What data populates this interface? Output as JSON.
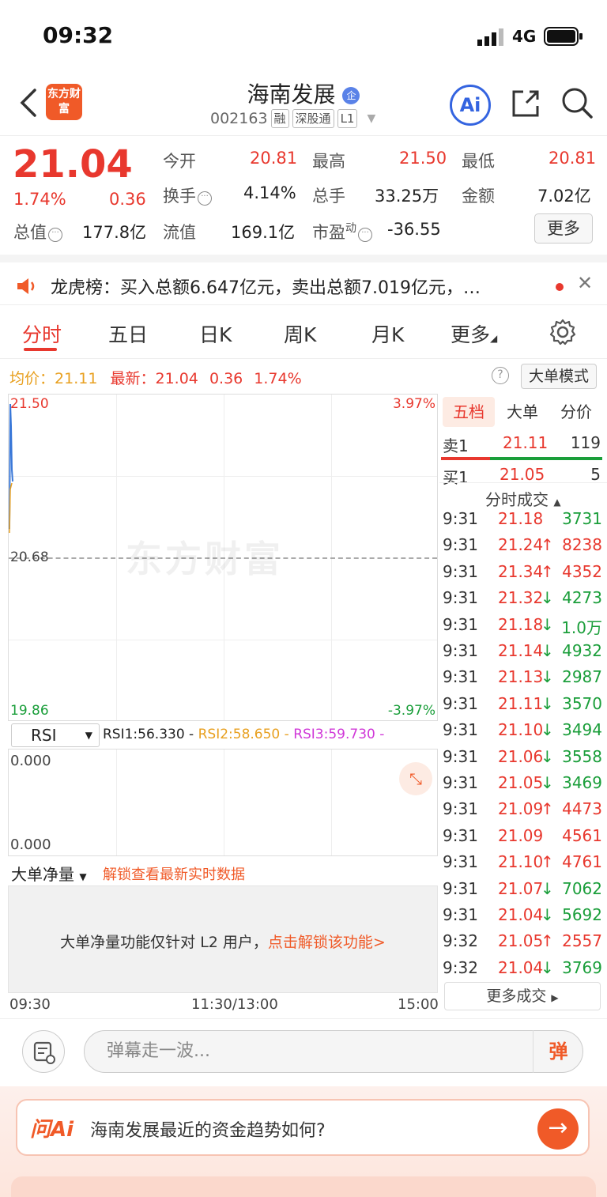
{
  "status": {
    "time": "09:32",
    "network": "4G"
  },
  "header": {
    "logo_text": "东方财富",
    "stock_name": "海南发展",
    "stock_code": "002163",
    "tags": [
      "融",
      "深股通",
      "L1"
    ],
    "ai_label": "Ai"
  },
  "quote": {
    "price": "21.04",
    "change_pct": "1.74%",
    "change_amt": "0.36",
    "open_label": "今开",
    "open": "20.81",
    "high_label": "最高",
    "high": "21.50",
    "low_label": "最低",
    "low": "20.81",
    "turnover_label": "换手",
    "turnover": "4.14%",
    "volume_label": "总手",
    "volume": "33.25万",
    "amount_label": "金额",
    "amount": "7.02亿",
    "mktcap_label": "总值",
    "mktcap": "177.8亿",
    "float_label": "流值",
    "float": "169.1亿",
    "pe_label": "市盈",
    "pe_sup": "动",
    "pe": "-36.55",
    "more_label": "更多"
  },
  "banner": {
    "text": "龙虎榜：买入总额6.647亿元，卖出总额7.019亿元，…"
  },
  "tabs": {
    "items": [
      "分时",
      "五日",
      "日K",
      "周K",
      "月K",
      "更多"
    ]
  },
  "avgline": {
    "avg_label": "均价：",
    "avg": "21.11",
    "latest_label": "最新：",
    "latest": "21.04",
    "chg": "0.36",
    "pct": "1.74%",
    "mode_label": "大单模式"
  },
  "chart": {
    "y_top": "21.50",
    "y_mid": "20.68",
    "y_bot": "19.86",
    "pct_top": "3.97%",
    "pct_bot": "-3.97%",
    "watermark": "东方财富"
  },
  "rsi": {
    "selector": "RSI",
    "rsi1": "RSI1:56.330 -",
    "rsi2": "RSI2:58.650 -",
    "rsi3": "RSI3:59.730 -",
    "y_top": "0.000",
    "y_bot": "0.000"
  },
  "bigorder": {
    "selector": "大单净量",
    "unlock_link": "解锁查看最新实时数据",
    "panel_text": "大单净量功能仅针对 L2 用户，",
    "panel_link": "点击解锁该功能>"
  },
  "time_axis": {
    "start": "09:30",
    "mid": "11:30/13:00",
    "end": "15:00"
  },
  "book": {
    "tabs": [
      "五档",
      "大单",
      "分价"
    ],
    "sell1": {
      "label": "卖1",
      "price": "21.11",
      "vol": "119"
    },
    "buy1": {
      "label": "买1",
      "price": "21.05",
      "vol": "5"
    },
    "trades_title": "分时成交",
    "trades": [
      {
        "t": "9:31",
        "p": "21.18",
        "a": "",
        "v": "3731",
        "c": "green"
      },
      {
        "t": "9:31",
        "p": "21.24",
        "a": "↑",
        "v": "8238",
        "c": "red"
      },
      {
        "t": "9:31",
        "p": "21.34",
        "a": "↑",
        "v": "4352",
        "c": "red"
      },
      {
        "t": "9:31",
        "p": "21.32",
        "a": "↓",
        "v": "4273",
        "c": "green"
      },
      {
        "t": "9:31",
        "p": "21.18",
        "a": "↓",
        "v": "1.0万",
        "c": "green"
      },
      {
        "t": "9:31",
        "p": "21.14",
        "a": "↓",
        "v": "4932",
        "c": "green"
      },
      {
        "t": "9:31",
        "p": "21.13",
        "a": "↓",
        "v": "2987",
        "c": "green"
      },
      {
        "t": "9:31",
        "p": "21.11",
        "a": "↓",
        "v": "3570",
        "c": "green"
      },
      {
        "t": "9:31",
        "p": "21.10",
        "a": "↓",
        "v": "3494",
        "c": "green"
      },
      {
        "t": "9:31",
        "p": "21.06",
        "a": "↓",
        "v": "3558",
        "c": "green"
      },
      {
        "t": "9:31",
        "p": "21.05",
        "a": "↓",
        "v": "3469",
        "c": "green"
      },
      {
        "t": "9:31",
        "p": "21.09",
        "a": "↑",
        "v": "4473",
        "c": "red"
      },
      {
        "t": "9:31",
        "p": "21.09",
        "a": "",
        "v": "4561",
        "c": "red"
      },
      {
        "t": "9:31",
        "p": "21.10",
        "a": "↑",
        "v": "4761",
        "c": "red"
      },
      {
        "t": "9:31",
        "p": "21.07",
        "a": "↓",
        "v": "7062",
        "c": "green"
      },
      {
        "t": "9:31",
        "p": "21.04",
        "a": "↓",
        "v": "5692",
        "c": "green"
      },
      {
        "t": "9:32",
        "p": "21.05",
        "a": "↑",
        "v": "2557",
        "c": "red"
      },
      {
        "t": "9:32",
        "p": "21.04",
        "a": "↓",
        "v": "3769",
        "c": "green"
      }
    ],
    "more_trades": "更多成交"
  },
  "danmaku": {
    "placeholder": "弹幕走一波...",
    "send_label": "弹"
  },
  "askai": {
    "logo": "问Ai",
    "question": "海南发展最近的资金趋势如何?"
  },
  "colors": {
    "up": "#e8382e",
    "down": "#1a9e3a",
    "accent": "#f05a28",
    "ai_blue": "#3464e0"
  }
}
